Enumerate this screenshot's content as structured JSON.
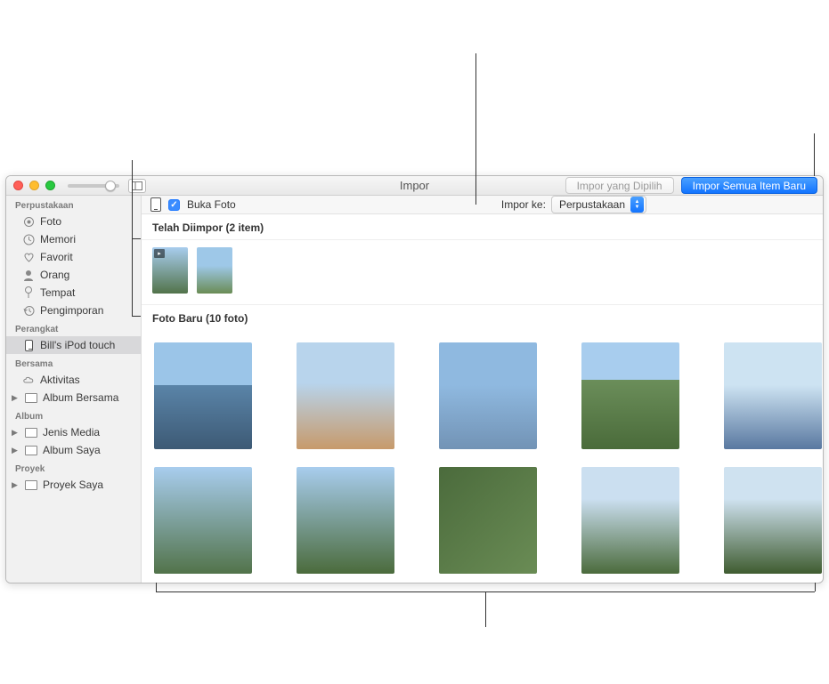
{
  "title": "Impor",
  "toolbar": {
    "import_selected": "Impor yang Dipilih",
    "import_all_new": "Impor Semua Item Baru"
  },
  "import_bar": {
    "open_photos_label": "Buka Foto",
    "open_photos_checked": true,
    "import_to_label": "Impor ke:",
    "import_to_value": "Perpustakaan"
  },
  "sidebar": {
    "groups": [
      {
        "header": "Perpustakaan",
        "items": [
          {
            "label": "Foto",
            "icon": "photos"
          },
          {
            "label": "Memori",
            "icon": "clock"
          },
          {
            "label": "Favorit",
            "icon": "heart"
          },
          {
            "label": "Orang",
            "icon": "person"
          },
          {
            "label": "Tempat",
            "icon": "pin"
          },
          {
            "label": "Pengimporan",
            "icon": "history"
          }
        ]
      },
      {
        "header": "Perangkat",
        "items": [
          {
            "label": "Bill's iPod touch",
            "icon": "device",
            "selected": true
          }
        ]
      },
      {
        "header": "Bersama",
        "items": [
          {
            "label": "Aktivitas",
            "icon": "cloud"
          },
          {
            "label": "Album Bersama",
            "icon": "folder",
            "expandable": true
          }
        ]
      },
      {
        "header": "Album",
        "items": [
          {
            "label": "Jenis Media",
            "icon": "folder",
            "expandable": true
          },
          {
            "label": "Album Saya",
            "icon": "folder",
            "expandable": true
          }
        ]
      },
      {
        "header": "Proyek",
        "items": [
          {
            "label": "Proyek Saya",
            "icon": "folder",
            "expandable": true
          }
        ]
      }
    ]
  },
  "sections": {
    "already_imported": "Telah Diimpor (2 item)",
    "new_photos": "Foto Baru (10 foto)"
  },
  "already_imported_count": 2,
  "new_photos_count": 10
}
